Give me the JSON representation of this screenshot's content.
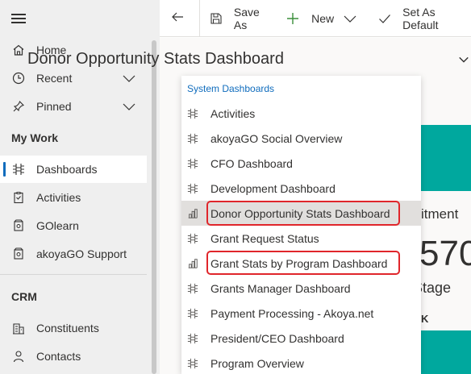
{
  "colors": {
    "accent": "#0f6cbd",
    "highlight_red": "#e0262b",
    "teal": "#00a89e",
    "sidebar_bg": "#efefef"
  },
  "sidebar": {
    "menu_icon": "hamburger-icon",
    "top_items": [
      {
        "label": "Home",
        "icon": "home-icon"
      },
      {
        "label": "Recent",
        "icon": "clock-icon",
        "expandable": true
      },
      {
        "label": "Pinned",
        "icon": "pin-icon",
        "expandable": true
      }
    ],
    "my_work": {
      "title": "My Work",
      "items": [
        {
          "label": "Dashboards",
          "icon": "dashboard-icon",
          "selected": true
        },
        {
          "label": "Activities",
          "icon": "clipboard-icon"
        },
        {
          "label": "GOlearn",
          "icon": "package-icon"
        },
        {
          "label": "akoyaGO Support",
          "icon": "package-icon"
        }
      ]
    },
    "crm": {
      "title": "CRM",
      "items": [
        {
          "label": "Constituents",
          "icon": "building-icon"
        },
        {
          "label": "Contacts",
          "icon": "person-icon"
        }
      ]
    }
  },
  "toolbar": {
    "back_icon": "back-arrow-icon",
    "save_as": "Save As",
    "new": "New",
    "set_default": "Set As Default"
  },
  "dashboard": {
    "title": "Donor Opportunity Stats Dashboard",
    "fragments": [
      "itment",
      "570",
      "Stage",
      "K"
    ]
  },
  "dropdown": {
    "header": "System Dashboards",
    "items": [
      {
        "label": "Activities",
        "icon": "dashboard-icon"
      },
      {
        "label": "akoyaGO Social Overview",
        "icon": "dashboard-icon"
      },
      {
        "label": "CFO Dashboard",
        "icon": "dashboard-icon"
      },
      {
        "label": "Development Dashboard",
        "icon": "dashboard-icon"
      },
      {
        "label": "Donor Opportunity Stats Dashboard",
        "icon": "chart-icon",
        "selected": true
      },
      {
        "label": "Grant Request Status",
        "icon": "dashboard-icon"
      },
      {
        "label": "Grant Stats by Program Dashboard",
        "icon": "chart-icon"
      },
      {
        "label": "Grants Manager Dashboard",
        "icon": "dashboard-icon"
      },
      {
        "label": "Payment Processing - Akoya.net",
        "icon": "dashboard-icon"
      },
      {
        "label": "President/CEO Dashboard",
        "icon": "dashboard-icon"
      },
      {
        "label": "Program Overview",
        "icon": "dashboard-icon"
      }
    ]
  }
}
